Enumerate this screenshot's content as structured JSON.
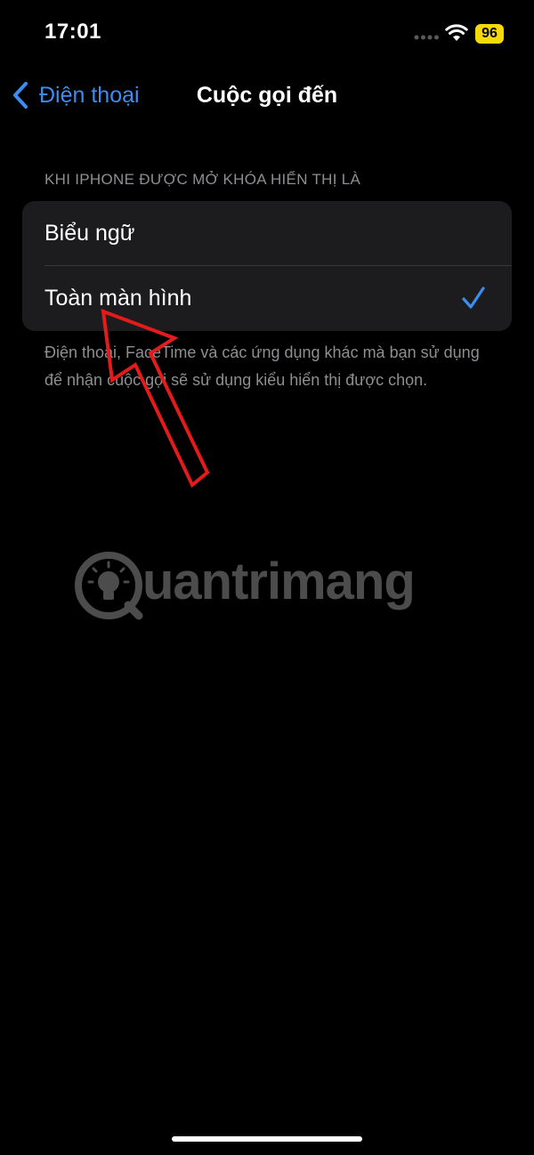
{
  "status_bar": {
    "time": "17:01",
    "battery": "96",
    "battery_color": "#f5d90a"
  },
  "nav": {
    "back_label": "Điện thoại",
    "title": "Cuộc gọi đến",
    "accent_color": "#3b8ef0"
  },
  "section": {
    "header": "KHI IPHONE ĐƯỢC MỞ KHÓA HIỂN THỊ LÀ",
    "options": [
      {
        "label": "Biểu ngữ",
        "selected": false
      },
      {
        "label": "Toàn màn hình",
        "selected": true
      }
    ],
    "footer": "Điện thoại, FaceTime và các ứng dụng khác mà bạn sử dụng để nhận cuộc gọi sẽ sử dụng kiểu hiển thị được chọn."
  },
  "watermark": {
    "text": "uantrimang",
    "logo_icon": "lightbulb-icon"
  },
  "icons": {
    "back": "chevron-left-icon",
    "check": "checkmark-icon",
    "wifi": "wifi-icon",
    "signal": "cellular-signal-icon"
  }
}
